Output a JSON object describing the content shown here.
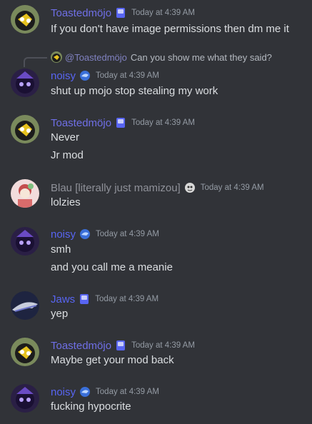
{
  "users": {
    "toasted": {
      "name": "Toastedmöjo",
      "color": "#6f6fe6"
    },
    "noisy": {
      "name": "noisy",
      "color": "#5865f2"
    },
    "blau": {
      "name": "Blau [literally just mamizou]",
      "color": "#8f9199"
    },
    "jaws": {
      "name": "Jaws",
      "color": "#5865f2"
    }
  },
  "messages": [
    {
      "user": "Toastedmöjo",
      "time": "Today at 4:39 AM",
      "lines": [
        "If you don't have image permissions then dm me it"
      ]
    },
    {
      "reply_to_user": "@Toastedmöjo",
      "reply_text": "Can you show me what they said?",
      "user": "noisy",
      "time": "Today at 4:39 AM",
      "lines": [
        "shut up mojo stop stealing my work"
      ]
    },
    {
      "user": "Toastedmöjo",
      "time": "Today at 4:39 AM",
      "lines": [
        "Never",
        "Jr mod"
      ]
    },
    {
      "user": "Blau [literally just mamizou]",
      "time": "Today at 4:39 AM",
      "lines": [
        "lolzies"
      ]
    },
    {
      "user": "noisy",
      "time": "Today at 4:39 AM",
      "lines": [
        "smh",
        "and you call me a meanie"
      ]
    },
    {
      "user": "Jaws",
      "time": "Today at 4:39 AM",
      "lines": [
        "yep"
      ]
    },
    {
      "user": "Toastedmöjo",
      "time": "Today at 4:39 AM",
      "lines": [
        "Maybe get your mod back"
      ]
    },
    {
      "user": "noisy",
      "time": "Today at 4:39 AM",
      "lines": [
        "fucking hypocrite"
      ]
    }
  ]
}
